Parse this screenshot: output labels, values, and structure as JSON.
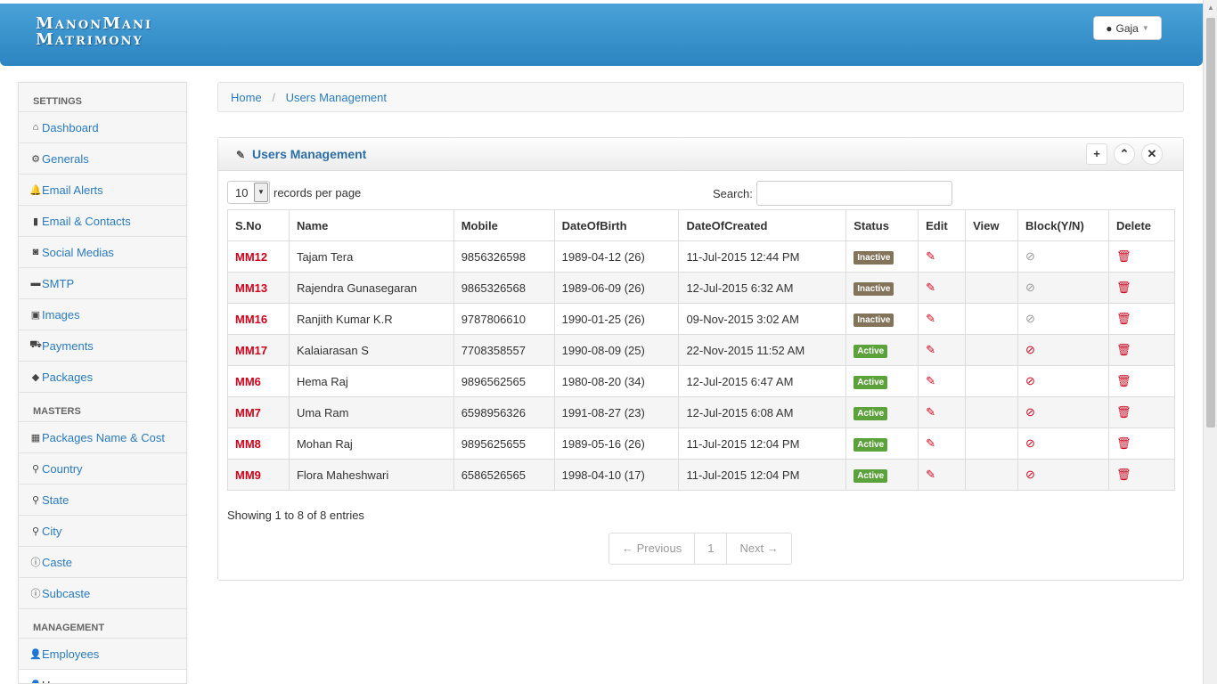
{
  "app": {
    "brand_line1": "ManonMani",
    "brand_line2": "Matrimony",
    "user": "Gaja"
  },
  "sidebar": {
    "sections": [
      {
        "title": "SETTINGS",
        "items": [
          {
            "label": "Dashboard",
            "icon": "home-icon",
            "glyph": "⌂"
          },
          {
            "label": "Generals",
            "icon": "gear-icon",
            "glyph": "⚙"
          },
          {
            "label": "Email Alerts",
            "icon": "bell-icon",
            "glyph": "🔔"
          },
          {
            "label": "Email & Contacts",
            "icon": "book-icon",
            "glyph": "▮"
          },
          {
            "label": "Social Medias",
            "icon": "camera-icon",
            "glyph": "◙"
          },
          {
            "label": "SMTP",
            "icon": "hdd-icon",
            "glyph": "▬"
          },
          {
            "label": "Images",
            "icon": "picture-icon",
            "glyph": "▣"
          },
          {
            "label": "Payments",
            "icon": "cart-icon",
            "glyph": "⛟"
          },
          {
            "label": "Packages",
            "icon": "tag-icon",
            "glyph": "◆"
          }
        ]
      },
      {
        "title": "MASTERS",
        "items": [
          {
            "label": "Packages Name & Cost",
            "icon": "gift-icon",
            "glyph": "▦"
          },
          {
            "label": "Country",
            "icon": "map-marker-icon",
            "glyph": "⚲"
          },
          {
            "label": "State",
            "icon": "map-marker-icon",
            "glyph": "⚲"
          },
          {
            "label": "City",
            "icon": "map-marker-icon",
            "glyph": "⚲"
          },
          {
            "label": "Caste",
            "icon": "info-circle-icon",
            "glyph": "ⓘ"
          },
          {
            "label": "Subcaste",
            "icon": "info-circle-icon",
            "glyph": "ⓘ"
          }
        ]
      },
      {
        "title": "MANAGEMENT",
        "items": [
          {
            "label": "Employees",
            "icon": "user-icon",
            "glyph": "👤"
          },
          {
            "label": "Users",
            "icon": "user-icon",
            "glyph": "👤"
          }
        ]
      }
    ]
  },
  "breadcrumb": {
    "home": "Home",
    "current": "Users Management"
  },
  "panel": {
    "title": "Users Management"
  },
  "controls": {
    "length_value": "10",
    "length_suffix": "records per page",
    "search_label": "Search:"
  },
  "table": {
    "headers": [
      "S.No",
      "Name",
      "Mobile",
      "DateOfBirth",
      "DateOfCreated",
      "Status",
      "Edit",
      "View",
      "Block(Y/N)",
      "Delete"
    ],
    "rows": [
      {
        "sno": "MM12",
        "name": "Tajam Tera",
        "mobile": "9856326598",
        "dob": "1989-04-12  (26)",
        "created": "11-Jul-2015 12:44 PM",
        "status": "Inactive"
      },
      {
        "sno": "MM13",
        "name": "Rajendra Gunasegaran",
        "mobile": "9865326568",
        "dob": "1989-06-09  (26)",
        "created": "12-Jul-2015 6:32 AM",
        "status": "Inactive"
      },
      {
        "sno": "MM16",
        "name": "Ranjith Kumar K.R",
        "mobile": "9787806610",
        "dob": "1990-01-25  (26)",
        "created": "09-Nov-2015 3:02 AM",
        "status": "Inactive"
      },
      {
        "sno": "MM17",
        "name": "Kalaiarasan S",
        "mobile": "7708358557",
        "dob": "1990-08-09  (25)",
        "created": "22-Nov-2015 11:52 AM",
        "status": "Active"
      },
      {
        "sno": "MM6",
        "name": "Hema Raj",
        "mobile": "9896562565",
        "dob": "1980-08-20  (34)",
        "created": "12-Jul-2015 6:47 AM",
        "status": "Active"
      },
      {
        "sno": "MM7",
        "name": "Uma Ram",
        "mobile": "6598956326",
        "dob": "1991-08-27  (23)",
        "created": "12-Jul-2015 6:08 AM",
        "status": "Active"
      },
      {
        "sno": "MM8",
        "name": "Mohan Raj",
        "mobile": "9895625655",
        "dob": "1989-05-16  (26)",
        "created": "11-Jul-2015 12:04 PM",
        "status": "Active"
      },
      {
        "sno": "MM9",
        "name": "Flora Maheshwari",
        "mobile": "6586526565",
        "dob": "1998-04-10  (17)",
        "created": "11-Jul-2015 12:04 PM",
        "status": "Active"
      }
    ]
  },
  "footer": {
    "info": "Showing 1 to 8 of 8 entries",
    "prev": "← Previous",
    "page": "1",
    "next": "Next →"
  },
  "colors": {
    "navbar": "#2c84c1",
    "link": "#2a7bbf",
    "sno": "#d0021b",
    "active": "#5ca23a",
    "inactive": "#827359"
  }
}
